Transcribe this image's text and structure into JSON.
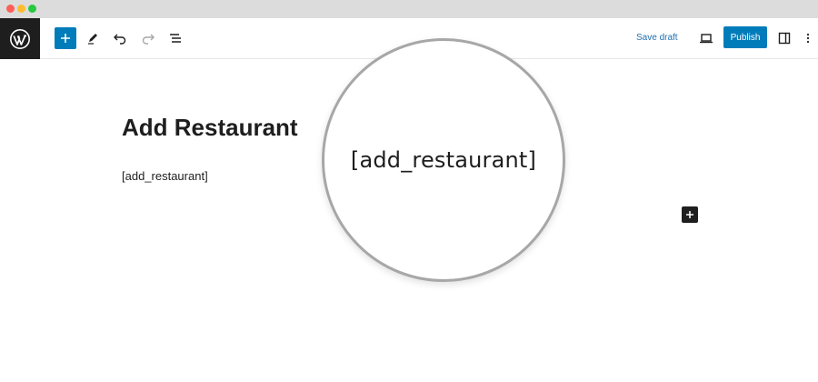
{
  "window": {
    "controls": [
      "close",
      "minimize",
      "maximize"
    ]
  },
  "toolbar": {
    "logo_icon": "wordpress-logo-icon",
    "inserter_icon": "plus-icon",
    "tools_icon": "pen-icon",
    "undo_icon": "undo-icon",
    "redo_icon": "redo-icon",
    "list_view_icon": "list-view-icon",
    "save_draft_label": "Save draft",
    "preview_icon": "laptop-icon",
    "publish_label": "Publish",
    "settings_icon": "sidebar-icon",
    "options_icon": "vertical-ellipsis-icon"
  },
  "editor": {
    "title": "Add Restaurant",
    "shortcode_block": "[add_restaurant]",
    "block_inserter_icon": "plus-icon"
  },
  "magnifier": {
    "text": "[add_restaurant]"
  },
  "colors": {
    "accent": "#007cba",
    "link": "#2271b1",
    "dark": "#1e1e1e",
    "titlebar": "#dcdcdc",
    "magnifier_border": "#a7a7a7"
  }
}
